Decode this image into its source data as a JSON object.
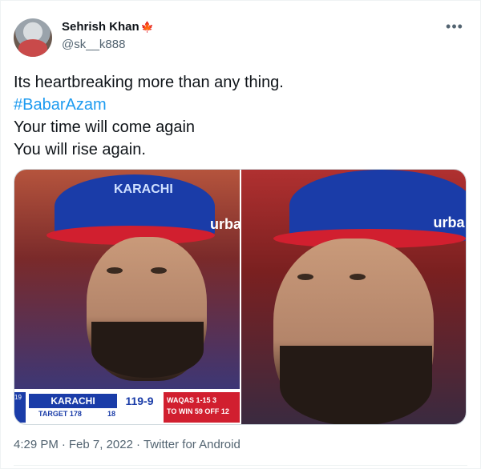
{
  "author": {
    "name": "Sehrish Khan",
    "flag": "🍁",
    "handle": "@sk__k888"
  },
  "tweet": {
    "line1": "Its heartbreaking more than any thing.",
    "hashtag": "#BabarAzam",
    "line3": "Your time will come again",
    "line4": "You will rise again."
  },
  "media": {
    "left_cap_text": "KARACHI",
    "brand_text": "urba",
    "scoreboard": {
      "edge_text": "19",
      "team": "KARACHI",
      "score": "119-9",
      "target_label": "TARGET 178",
      "target_value": "18",
      "info_line1": "WAQAS 1-15 3",
      "info_line2": "TO WIN 59 OFF 12"
    }
  },
  "footer": {
    "time": "4:29 PM",
    "date": "Feb 7, 2022",
    "source": "Twitter for Android"
  },
  "icons": {
    "more": "more-horizontal-icon"
  }
}
